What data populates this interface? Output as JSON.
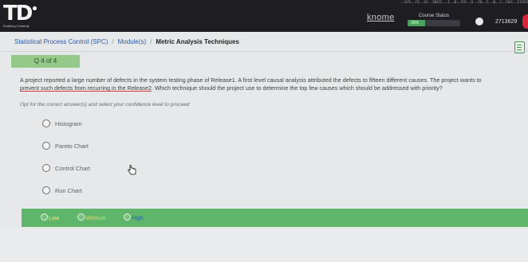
{
  "header": {
    "logo_text": "TD",
    "logo_tagline": "Enabling Certainty",
    "url_fragment": "...s/s.../s...s/.../acc....t...a...ns...s.../a...t...a.../.../ac...ccou",
    "knome_label": "knome",
    "course_status_label": "Course Status",
    "progress_percent": 33,
    "progress_text": "33%",
    "user_id": "2713629",
    "icons": [
      "user-icon"
    ]
  },
  "breadcrumb": {
    "items": [
      "Statistical Process Control (SPC)",
      "Module(s)",
      "Metric Analysis Techniques"
    ],
    "separator": "/"
  },
  "question": {
    "counter": "Q 4 of 4",
    "text_line1": "A project reported a large number of defects in the system testing phase of Release1. A first level causal analysis attributed the defects to fifteen different causes. The project wants to",
    "text_line2_emph": "prevent such defects from recurring in the Release2",
    "text_line2_rest": ". Which technique should the project use to determine the top few causes which should be addressed with priority?",
    "instruction": "Opt for the correct answer(s) and select your confidence level to proceed",
    "options": [
      "Histogram",
      "Pareto Chart",
      "Control Chart",
      "Run Chart"
    ]
  },
  "confidence": {
    "options": [
      "Low",
      "Medium",
      "High"
    ]
  },
  "colors": {
    "topbar": "#1d1d22",
    "accent_green": "#5fb66a",
    "badge_green": "#94c98a",
    "link_blue": "#2a5aa8",
    "alert_red": "#d8243a"
  },
  "icons": [
    "notes-icon",
    "cursor-hand-icon"
  ]
}
